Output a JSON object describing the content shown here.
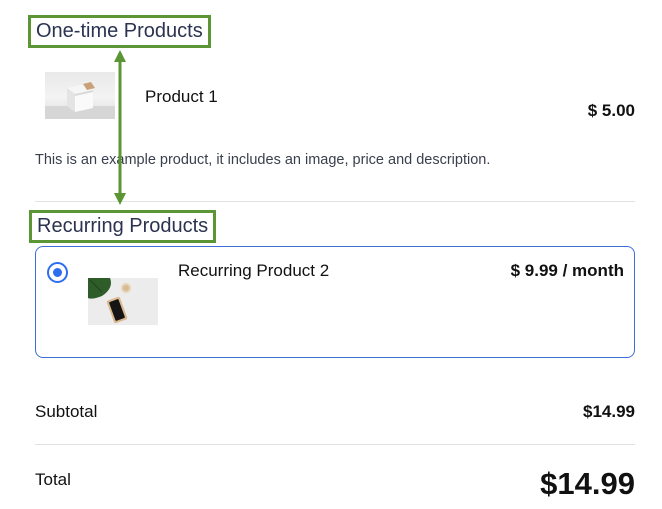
{
  "one_time_section": {
    "title": "One-time Products",
    "product": {
      "name": "Product 1",
      "price": "$ 5.00",
      "description": "This is an example product, it includes an image, price and description.",
      "image_icon": "box-product-photo"
    }
  },
  "recurring_section": {
    "title": "Recurring Products",
    "product": {
      "name": "Recurring Product 2",
      "price": "$ 9.99 / month",
      "selected": true,
      "image_icon": "phone-plant-product-photo"
    }
  },
  "summary": {
    "subtotal_label": "Subtotal",
    "subtotal_value": "$14.99",
    "total_label": "Total",
    "total_value": "$14.99"
  },
  "colors": {
    "highlight_box": "#5b9536",
    "card_border": "#3b6fd8",
    "radio": "#2d6df0"
  }
}
